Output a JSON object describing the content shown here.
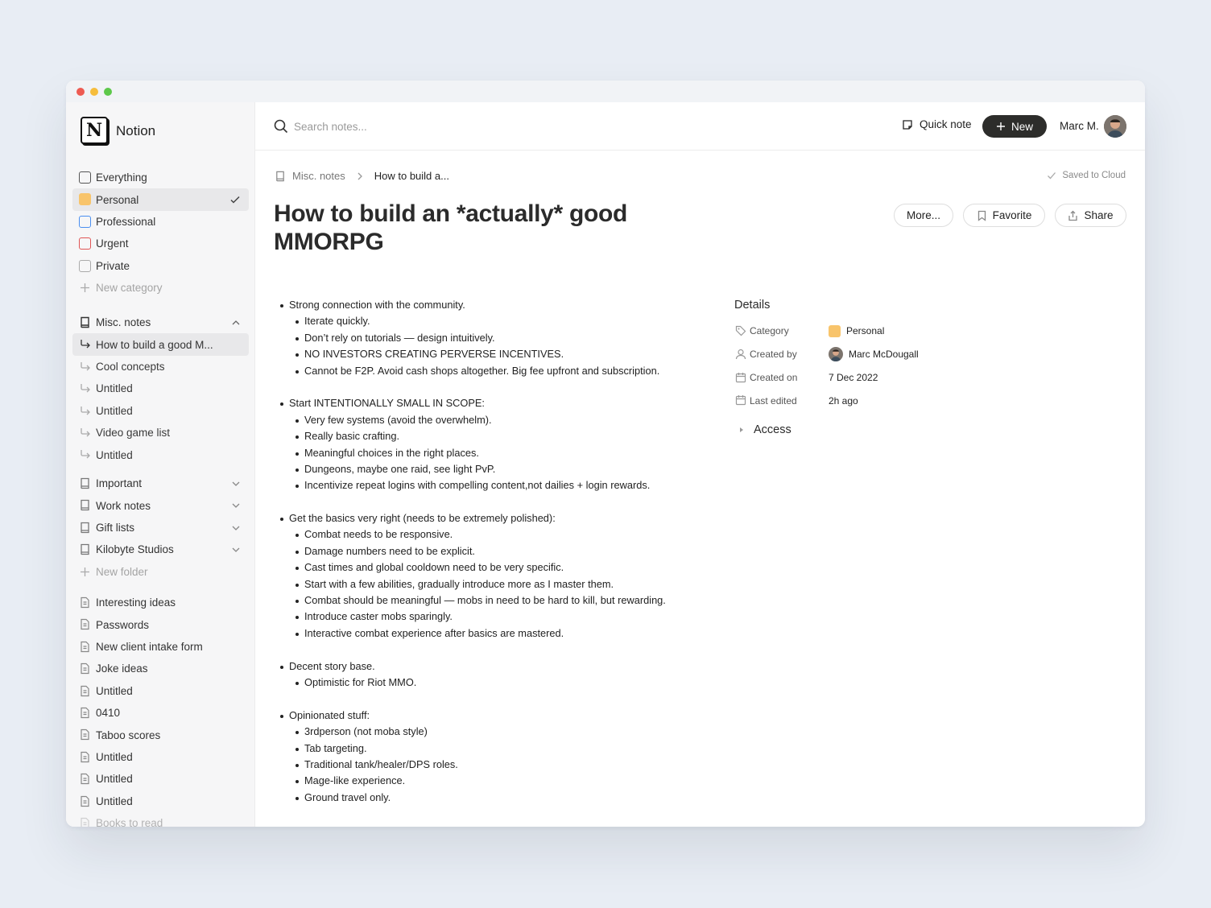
{
  "app": {
    "name": "Notion"
  },
  "sidebar": {
    "categories": [
      {
        "label": "Everything",
        "color": "#555555",
        "filled": false,
        "active": false
      },
      {
        "label": "Personal",
        "color": "#f8c46b",
        "filled": true,
        "active": true
      },
      {
        "label": "Professional",
        "color": "#4a8ff0",
        "filled": false,
        "active": false
      },
      {
        "label": "Urgent",
        "color": "#e05555",
        "filled": false,
        "active": false
      },
      {
        "label": "Private",
        "color": "#aaaaaa",
        "filled": false,
        "active": false
      }
    ],
    "new_category": "New category",
    "folder": {
      "label": "Misc. notes",
      "notes": [
        "How to build a good M...",
        "Cool concepts",
        "Untitled",
        "Untitled",
        "Video game list",
        "Untitled"
      ]
    },
    "folders": [
      "Important",
      "Work notes",
      "Gift lists",
      "Kilobyte Studios"
    ],
    "new_folder": "New folder",
    "pages": [
      "Interesting ideas",
      "Passwords",
      "New client intake form",
      "Joke ideas",
      "Untitled",
      "0410",
      "Taboo scores",
      "Untitled",
      "Untitled",
      "Untitled",
      "Books to read"
    ]
  },
  "topbar": {
    "search_placeholder": "Search notes...",
    "quick_note": "Quick note",
    "new_label": "New",
    "user_name": "Marc M."
  },
  "breadcrumb": {
    "folder": "Misc. notes",
    "current": "How to build a..."
  },
  "status": {
    "saved": "Saved to Cloud"
  },
  "note": {
    "title": "How to build an *actually* good MMORPG",
    "actions": {
      "more": "More...",
      "favorite": "Favorite",
      "share": "Share"
    },
    "sections": [
      {
        "head": "Strong connection with the community.",
        "items": [
          "Iterate quickly.",
          "Don’t rely on tutorials — design intuitively.",
          "NO INVESTORS CREATING PERVERSE INCENTIVES.",
          "Cannot be F2P. Avoid cash shops altogether. Big fee upfront and subscription."
        ]
      },
      {
        "head": "Start INTENTIONALLY SMALL IN SCOPE:",
        "items": [
          "Very few systems (avoid the overwhelm).",
          "Really basic crafting.",
          "Meaningful choices in the right places.",
          "Dungeons, maybe one raid, see light PvP.",
          "Incentivize repeat logins with compelling content,not dailies + login rewards."
        ]
      },
      {
        "head": "Get the basics very right (needs to be extremely polished):",
        "items": [
          "Combat needs to be responsive.",
          "Damage numbers need to be explicit.",
          "Cast times and global cooldown need to be very specific.",
          "Start with a few abilities, gradually introduce more as I master them.",
          "Combat should be meaningful — mobs in need to be hard to kill, but rewarding.",
          "Introduce caster mobs sparingly.",
          "Interactive combat experience after basics are mastered."
        ]
      },
      {
        "head": "Decent story base.",
        "items": [
          "Optimistic for Riot MMO."
        ]
      },
      {
        "head": "Opinionated stuff:",
        "items": [
          "3rdperson (not moba style)",
          "Tab targeting.",
          "Traditional tank/healer/DPS roles.",
          "Mage-like experience.",
          "Ground travel only."
        ]
      }
    ]
  },
  "details": {
    "heading": "Details",
    "category_label": "Category",
    "category_value": "Personal",
    "category_color": "#f8c46b",
    "created_by_label": "Created by",
    "created_by_value": "Marc McDougall",
    "created_on_label": "Created on",
    "created_on_value": "7 Dec 2022",
    "last_edited_label": "Last edited",
    "last_edited_value": "2h ago",
    "access_label": "Access"
  }
}
